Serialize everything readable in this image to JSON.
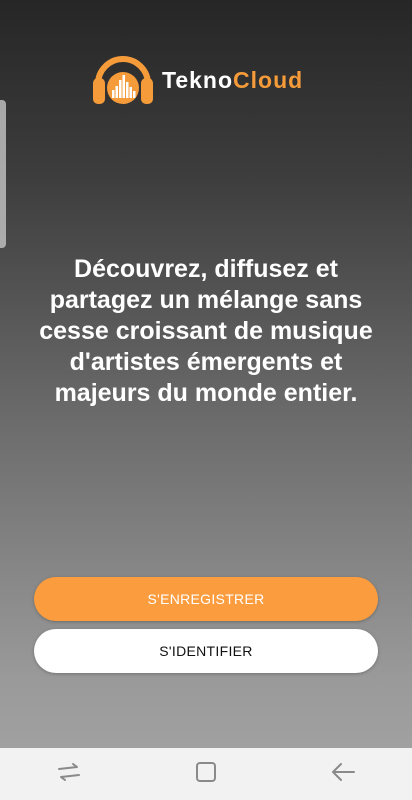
{
  "brand": {
    "part1": "Tekno",
    "part2": "Cloud",
    "accent_color": "#f59b3a",
    "icon": "headphones-logo-icon"
  },
  "tagline": "Découvrez, diffusez et partagez un mélange sans cesse croissant de musique d'artistes émergents et majeurs du monde entier.",
  "buttons": {
    "register_label": "S'ENREGISTRER",
    "login_label": "S'IDENTIFIER",
    "register_color": "#fb9d3f"
  },
  "navbar": {
    "icons": [
      "recent-apps-icon",
      "home-icon",
      "back-icon"
    ]
  }
}
